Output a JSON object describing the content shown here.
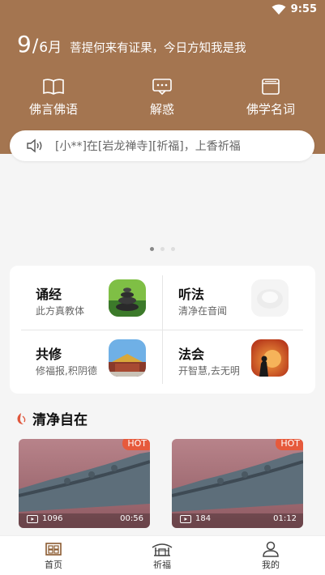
{
  "status": {
    "time": "9:55"
  },
  "header": {
    "date_day": "9",
    "date_sep": "/",
    "date_month": "6月",
    "quote": "菩提何来有证果，今日方知我是我",
    "bg_color": "#a47550"
  },
  "nav": [
    {
      "label": "佛言佛语",
      "icon": "book-icon"
    },
    {
      "label": "解惑",
      "icon": "chat-icon"
    },
    {
      "label": "佛学名词",
      "icon": "card-icon"
    }
  ],
  "notice": {
    "text": "[小**]在[岩龙禅寺][祈福]，上香祈福",
    "icon": "speaker-icon"
  },
  "banner": {
    "page": 1,
    "pages": 3
  },
  "features": [
    {
      "title": "诵经",
      "subtitle": "此方真教体"
    },
    {
      "title": "听法",
      "subtitle": "清净在音闻"
    },
    {
      "title": "共修",
      "subtitle": "修福报,积阴德"
    },
    {
      "title": "法会",
      "subtitle": "开智慧,去无明"
    }
  ],
  "section": {
    "title": "清净自在"
  },
  "videos": [
    {
      "badge": "HOT",
      "plays": "1096",
      "duration": "00:56"
    },
    {
      "badge": "HOT",
      "plays": "184",
      "duration": "01:12"
    }
  ],
  "tabbar": [
    {
      "label": "首页",
      "icon": "home-icon"
    },
    {
      "label": "祈福",
      "icon": "temple-icon"
    },
    {
      "label": "我的",
      "icon": "user-icon"
    }
  ]
}
